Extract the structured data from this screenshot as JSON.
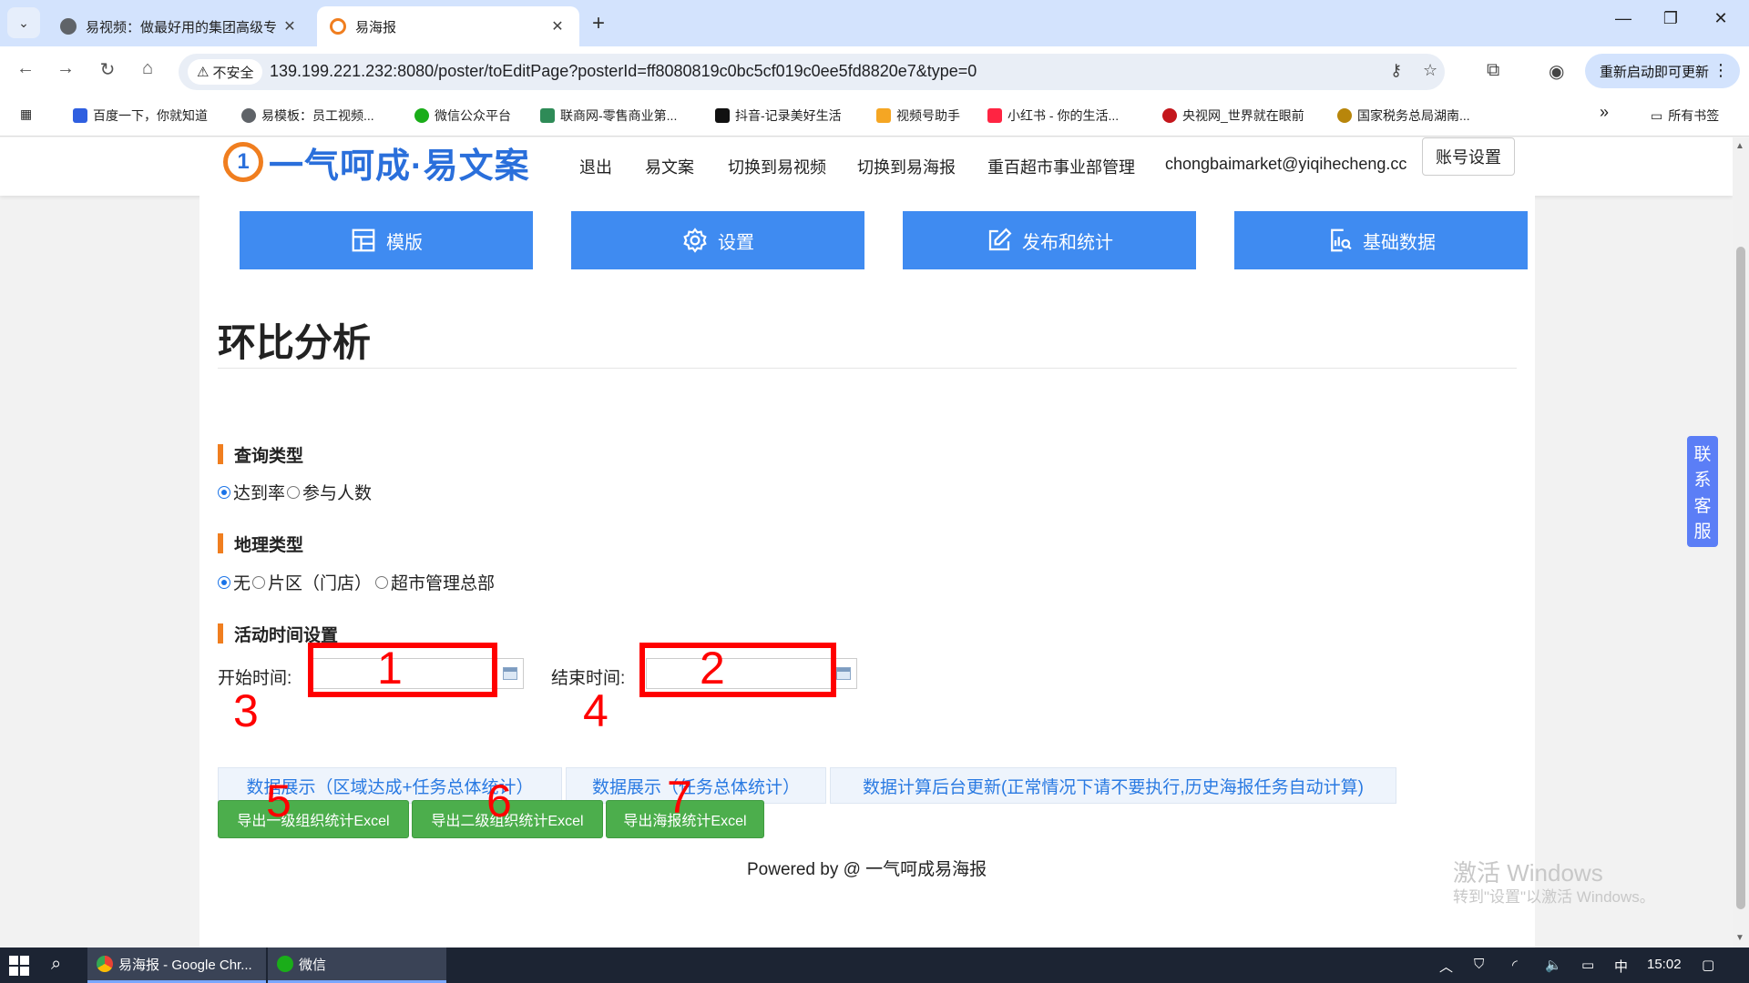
{
  "browser": {
    "tabs": [
      {
        "title": "易视频：做最好用的集团高级专",
        "active": false
      },
      {
        "title": "易海报",
        "active": true
      }
    ],
    "new_tab_symbol": "+",
    "window_controls": {
      "minimize": "—",
      "restore": "❐",
      "close": "✕"
    },
    "security_label": "不安全",
    "url": "139.199.221.232:8080/poster/toEditPage?posterId=ff8080819c0bc5cf019c0ee5fd8820e7&type=0",
    "update_button": "重新启动即可更新",
    "bookmarks": [
      {
        "label": "百度一下，你就知道",
        "color": "#2f5fe0"
      },
      {
        "label": "易模板：员工视频...",
        "color": "#5f6368"
      },
      {
        "label": "微信公众平台",
        "color": "#1aad19"
      },
      {
        "label": "联商网-零售商业第...",
        "color": "#2e8b57"
      },
      {
        "label": "抖音-记录美好生活",
        "color": "#111111"
      },
      {
        "label": "视频号助手",
        "color": "#f5a623"
      },
      {
        "label": "小红书 - 你的生活...",
        "color": "#ff2442"
      },
      {
        "label": "央视网_世界就在眼前",
        "color": "#c4161c"
      },
      {
        "label": "国家税务总局湖南...",
        "color": "#b8860b"
      }
    ],
    "more_bookmarks": "»",
    "all_bookmarks": "所有书签"
  },
  "site": {
    "logo_char": "1",
    "logo_text": "一气呵成·易文案",
    "nav": [
      "退出",
      "易文案",
      "切换到易视频",
      "切换到易海报",
      "重百超市事业部管理",
      "chongbaimarket@yiqihecheng.cc"
    ],
    "account_button": "账号设置",
    "tiles": [
      {
        "label": "模版",
        "icon": "layout-icon"
      },
      {
        "label": "设置",
        "icon": "gear-icon"
      },
      {
        "label": "发布和统计",
        "icon": "edit-icon"
      },
      {
        "label": "基础数据",
        "icon": "report-icon"
      }
    ]
  },
  "page": {
    "title": "环比分析",
    "query_type": {
      "label": "查询类型",
      "options": [
        "达到率",
        "参与人数"
      ],
      "selected": 0
    },
    "geo_type": {
      "label": "地理类型",
      "options": [
        "无",
        "片区（门店）",
        "超市管理总部"
      ],
      "selected": 0
    },
    "time_settings": {
      "label": "活动时间设置",
      "start_label": "开始时间:",
      "start_value": "",
      "end_label": "结束时间:",
      "end_value": ""
    },
    "buttons": {
      "show_region": "数据展示（区域达成+任务总体统计）",
      "show_task": "数据展示（任务总体统计）",
      "recalc": "数据计算后台更新(正常情况下请不要执行,历史海报任务自动计算)",
      "export_level1": "导出一级组织统计Excel",
      "export_level2": "导出二级组织统计Excel",
      "export_poster": "导出海报统计Excel"
    },
    "powered_by": "Powered by @ 一气呵成易海报",
    "customer_service": [
      "联",
      "系",
      "客",
      "服"
    ]
  },
  "annotations": [
    "1",
    "2",
    "3",
    "4",
    "5",
    "6",
    "7"
  ],
  "watermark": {
    "line1": "激活 Windows",
    "line2": "转到\"设置\"以激活 Windows。"
  },
  "taskbar": {
    "apps": [
      {
        "label": "易海报 - Google Chr...",
        "active": true
      },
      {
        "label": "微信",
        "active": false
      }
    ],
    "ime": "中",
    "time": "15:02"
  },
  "colors": {
    "accent": "#3f8bf1",
    "brand_orange": "#f07e1f",
    "export_green": "#4cae4c",
    "annotation_red": "#ff0000",
    "service_tab": "#5b7ef6"
  }
}
